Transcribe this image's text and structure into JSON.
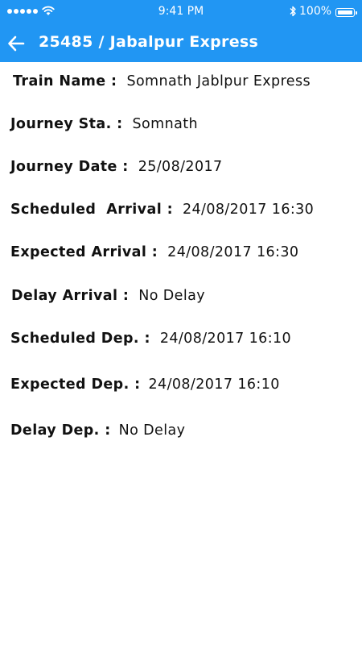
{
  "status_bar": {
    "time": "9:41 PM",
    "battery": "100%",
    "battery_level": 1.0
  },
  "toolbar": {
    "title": "25485 / Jabalpur Express"
  },
  "details": {
    "train_name_label": "Train Name :",
    "train_name_value": "Somnath Jablpur Express",
    "journey_station_label": "Journey Sta. :",
    "journey_station_value": "Somnath",
    "journey_date_label": "Journey Date :",
    "journey_date_value": "25/08/2017",
    "scheduled_arrival_label": "Scheduled  Arrival :",
    "scheduled_arrival_value": "24/08/2017 16:30",
    "expected_arrival_label": "Expected Arrival :",
    "expected_arrival_value": "24/08/2017 16:30",
    "delay_arrival_label": "Delay Arrival :",
    "delay_arrival_value": "No Delay",
    "scheduled_dep_label": "Scheduled Dep. :",
    "scheduled_dep_value": "24/08/2017 16:10",
    "expected_dep_label": "Expected Dep. :",
    "expected_dep_value": "24/08/2017 16:10",
    "delay_dep_label": "Delay Dep. :",
    "delay_dep_value": "No Delay"
  },
  "colors": {
    "app_bar": "#2196f3",
    "text": "#111111",
    "background": "#ffffff"
  },
  "icons": {
    "back": "arrow-left-icon",
    "wifi": "wifi-icon",
    "bluetooth": "bluetooth-icon",
    "battery": "battery-icon",
    "signal": "signal-icon"
  }
}
